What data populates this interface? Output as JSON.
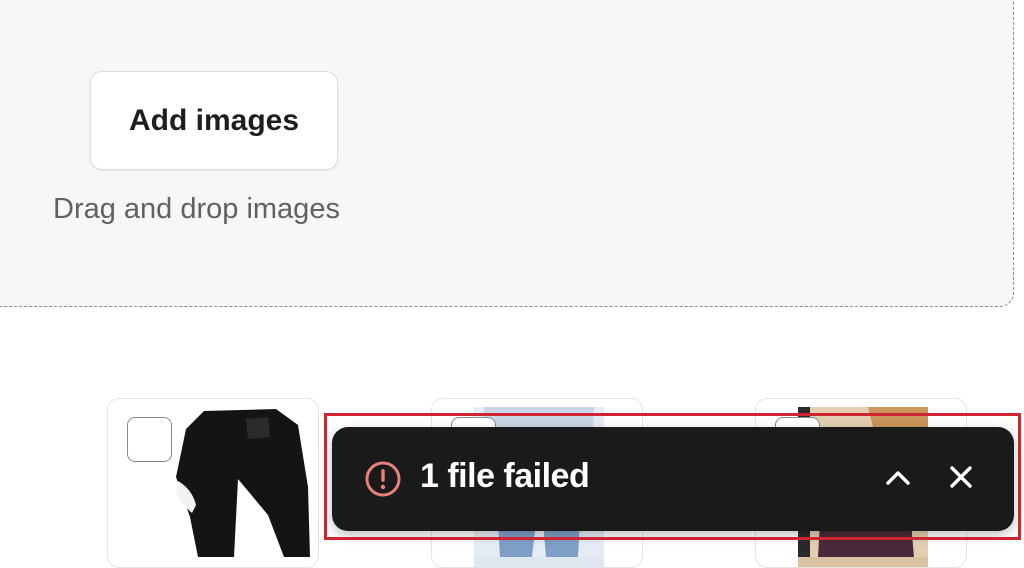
{
  "dropzone": {
    "add_button_label": "Add images",
    "hint": "Drag and drop images"
  },
  "media_cards": [
    {
      "image": "black-jeans-photo",
      "selected": false
    },
    {
      "image": "blue-jeans-photo",
      "selected": false
    },
    {
      "image": "brown-outfit-photo",
      "selected": false
    }
  ],
  "toast": {
    "message": "1 file failed",
    "status_icon": "alert-circle-icon",
    "expand_icon": "chevron-up-icon",
    "close_icon": "close-icon"
  },
  "colors": {
    "dropzone_bg": "#f7f7f7",
    "toast_bg": "#1a1a1a",
    "error_icon": "#e8817c",
    "highlight_outline": "#cf2533"
  }
}
